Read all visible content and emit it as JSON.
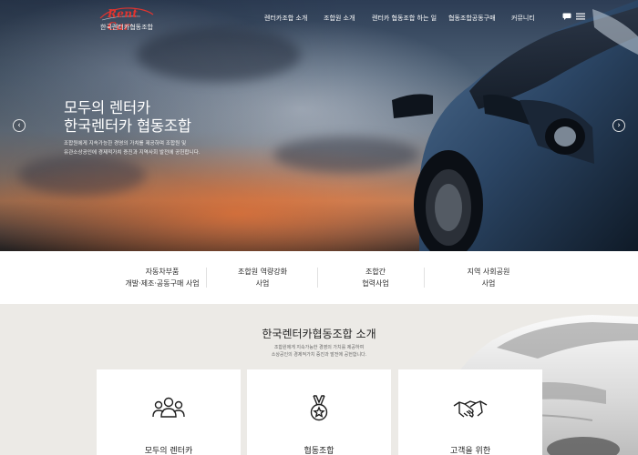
{
  "header": {
    "logo_text": "Rent Car",
    "logo_subtitle": "한국렌터카협동조합",
    "nav": [
      {
        "label": "렌터카조합 소개"
      },
      {
        "label": "조합원 소개"
      },
      {
        "label": "렌터카 협동조합 하는 일"
      },
      {
        "label": "협동조합공동구매"
      },
      {
        "label": "커뮤니티"
      }
    ],
    "icons": [
      "chat-icon",
      "menu-icon"
    ]
  },
  "hero": {
    "title_line1": "모두의 렌터카",
    "title_line2": "한국렌터카 협동조합",
    "desc_line1": "조합원에게 지속가능한 경영의 가치를 제공하며 조합원 및",
    "desc_line2": "유관소상공인에 경제적가치 증진과 지역사회 발전에 공헌합니다.",
    "prev_label": "‹",
    "next_label": "›"
  },
  "business": [
    {
      "line1": "자동차부품",
      "line2": "개발·제조·공동구매 사업"
    },
    {
      "line1": "조합원 역량강화",
      "line2": "사업"
    },
    {
      "line1": "조합간",
      "line2": "협력사업"
    },
    {
      "line1": "지역 사회공원",
      "line2": "사업"
    }
  ],
  "intro": {
    "title": "한국렌터카협동조합 소개",
    "desc_line1": "조합원에게 지속가능한 경영의 가치를 제공하여",
    "desc_line2": "소상공인의 경제적가치 증진과 발전에 공헌합니다.",
    "cards": [
      {
        "title": "모두의 렌터카",
        "icon": "people-icon"
      },
      {
        "title": "협동조합",
        "icon": "medal-icon"
      },
      {
        "title": "고객을 위한",
        "icon": "handshake-icon"
      }
    ]
  },
  "colors": {
    "logo_red": "#e0342f",
    "intro_bg": "#eceae6"
  }
}
